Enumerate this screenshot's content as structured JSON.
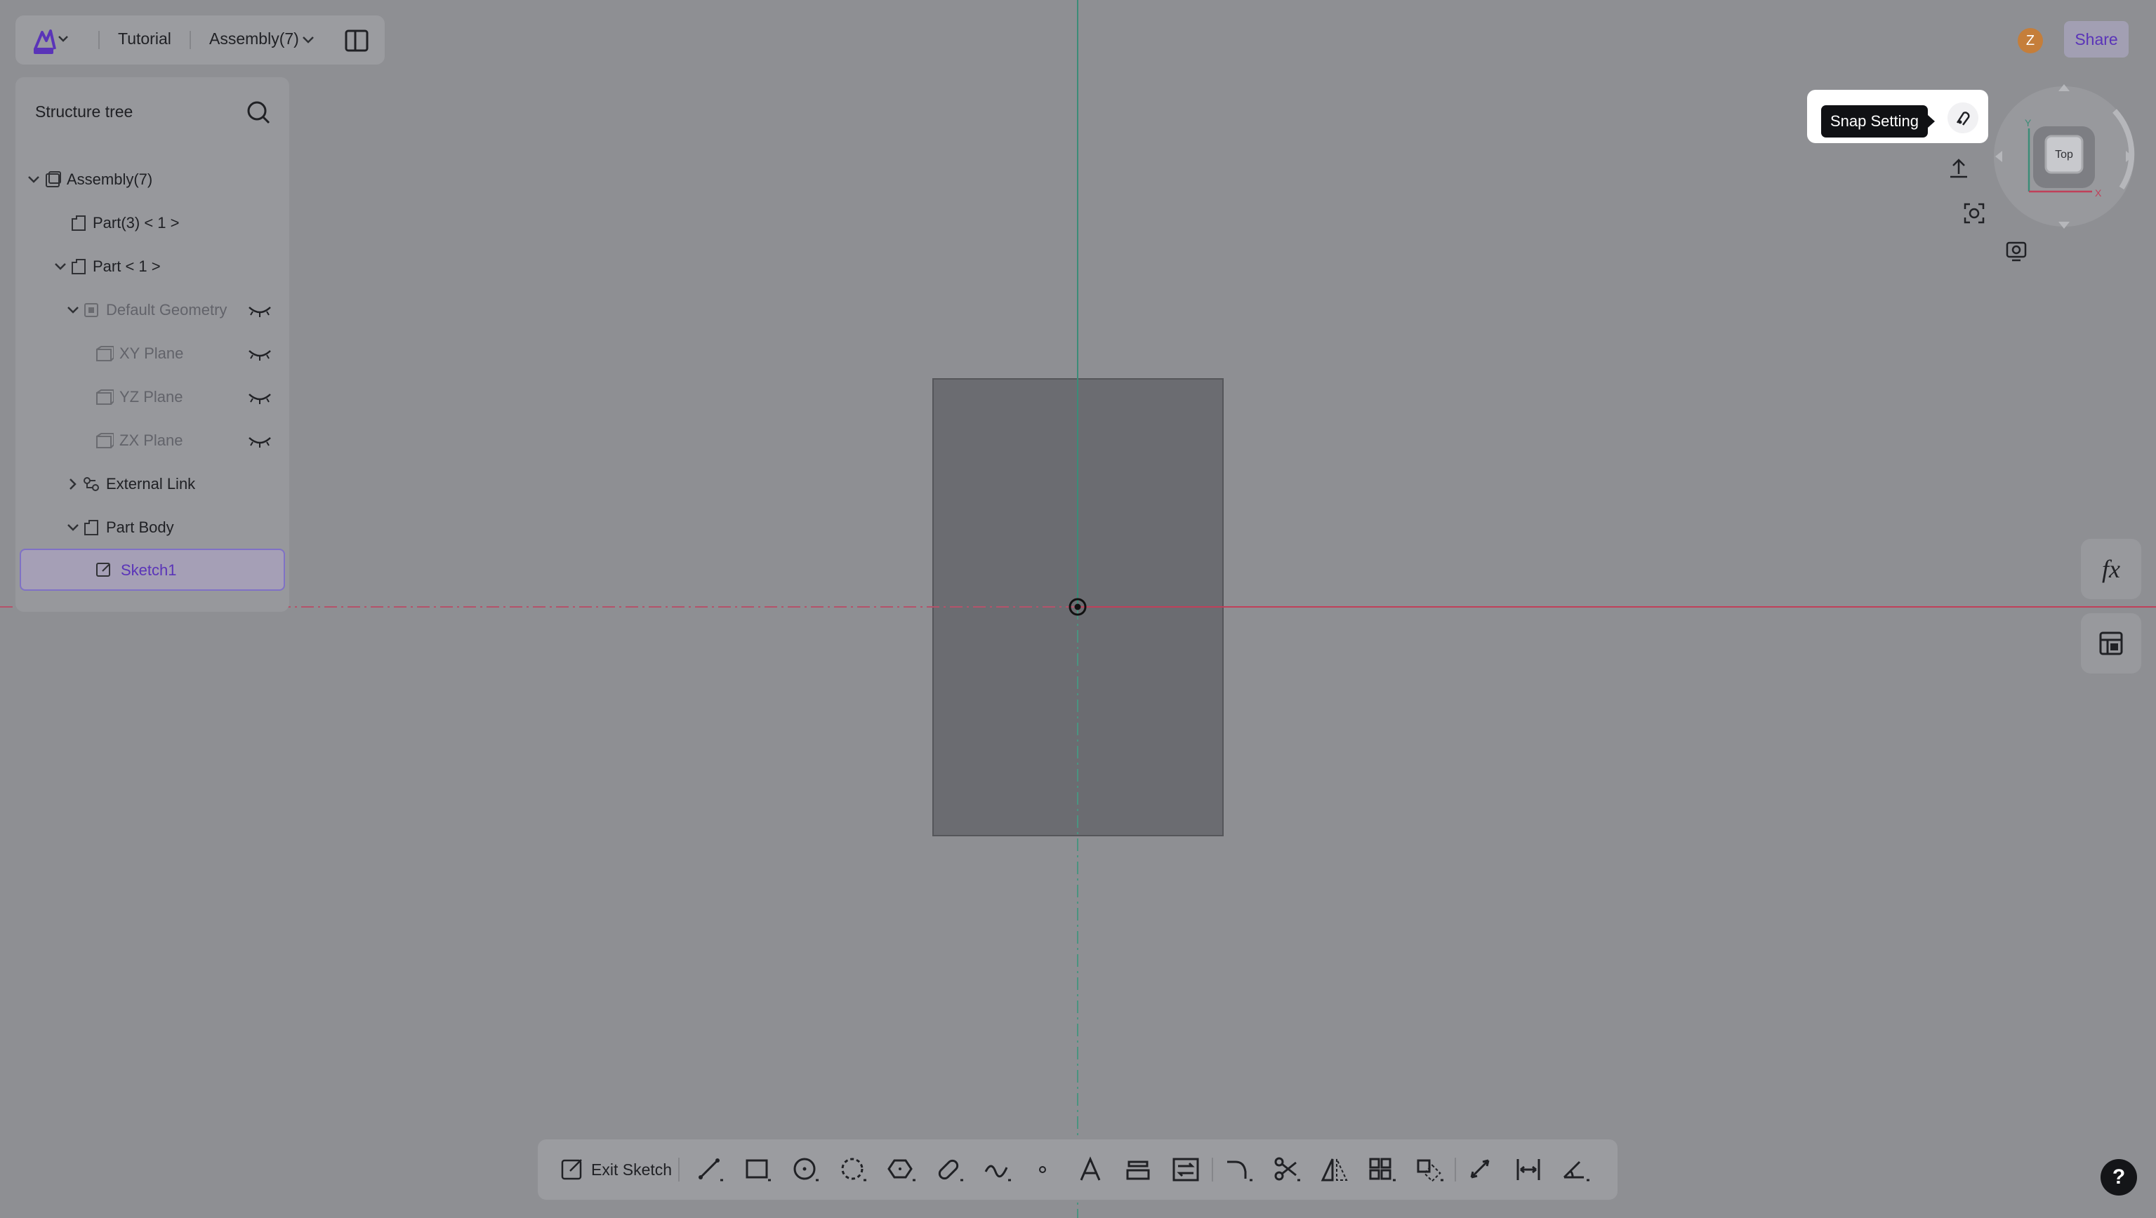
{
  "header": {
    "project": "Tutorial",
    "assembly": "Assembly(7)"
  },
  "tree": {
    "title": "Structure tree",
    "items": [
      {
        "label": "Assembly(7)"
      },
      {
        "label": "Part(3) < 1 >"
      },
      {
        "label": "Part < 1 >"
      },
      {
        "label": "Default Geometry"
      },
      {
        "label": "XY Plane"
      },
      {
        "label": "YZ Plane"
      },
      {
        "label": "ZX Plane"
      },
      {
        "label": "External Link"
      },
      {
        "label": "Part Body"
      },
      {
        "label": "Sketch1"
      }
    ]
  },
  "topright": {
    "avatar": "Z",
    "share": "Share"
  },
  "snap": {
    "tooltip": "Snap Setting"
  },
  "viewcube": {
    "face": "Top",
    "axis_x": "X",
    "axis_y": "Y"
  },
  "rightpanel": {
    "fx": "fx"
  },
  "toolbar": {
    "exit": "Exit Sketch"
  },
  "help": "?",
  "colors": {
    "accent": "#5a34b8",
    "canvas": "#8e8f93",
    "sketch_rect": "#6b6c71",
    "x_axis": "#c0405a",
    "y_axis": "#3c8c78"
  }
}
